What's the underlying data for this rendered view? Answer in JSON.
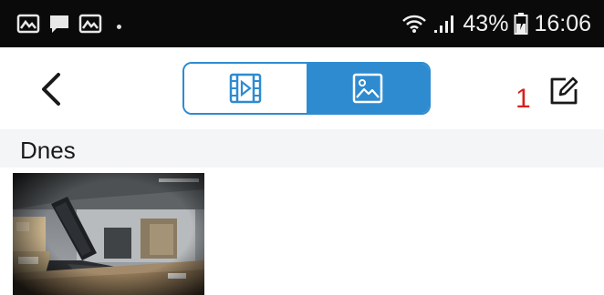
{
  "status_bar": {
    "battery": "43%",
    "time": "16:06",
    "left_icons": [
      "gallery-icon",
      "message-icon",
      "gallery-icon"
    ],
    "right_icons": [
      "wifi-icon",
      "signal-icon",
      "battery-icon"
    ]
  },
  "header": {
    "back_icon": "chevron-left-icon",
    "tabs": [
      {
        "icon": "video-film-icon",
        "selected": false
      },
      {
        "icon": "image-icon",
        "selected": true
      }
    ],
    "annotation": "1",
    "edit_icon": "edit-icon"
  },
  "section": {
    "title": "Dnes"
  },
  "colors": {
    "accent": "#2e8bd0",
    "status_bar_bg": "#0a0a0a",
    "section_bg": "#f4f5f7",
    "annotation": "#d61f1f"
  }
}
